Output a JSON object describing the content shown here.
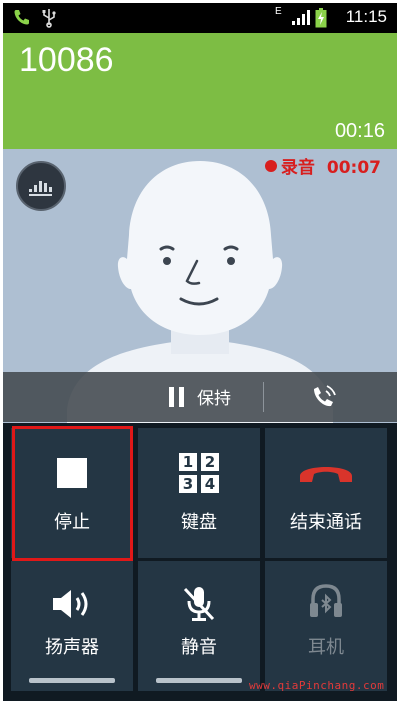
{
  "status_bar": {
    "time": "11:15",
    "icons": [
      "phone-call-icon",
      "usb-icon",
      "e-network-icon",
      "signal-icon",
      "battery-charging-icon"
    ],
    "network_letter": "E"
  },
  "call": {
    "number": "10086",
    "duration": "00:16",
    "recording_label": "录音",
    "recording_time": "00:07"
  },
  "controls": {
    "hold_label": "保持"
  },
  "buttons": [
    {
      "label": "停止",
      "icon": "stop-icon"
    },
    {
      "label": "键盘",
      "icon": "dialpad-icon",
      "keys": [
        "1",
        "2",
        "3",
        "4"
      ]
    },
    {
      "label": "结束通话",
      "icon": "end-call-icon"
    },
    {
      "label": "扬声器",
      "icon": "speaker-icon"
    },
    {
      "label": "静音",
      "icon": "mute-icon"
    },
    {
      "label": "耳机",
      "icon": "bluetooth-headset-icon",
      "disabled": true
    }
  ],
  "colors": {
    "caller_header": "#7dbd44",
    "photo_background": "#aebfd2",
    "button_background": "#243644",
    "recording_red": "#d81e1e",
    "end_call_red": "#d9342b",
    "highlight_border": "#e01818"
  },
  "watermark": "www.qiaPinchang.com"
}
